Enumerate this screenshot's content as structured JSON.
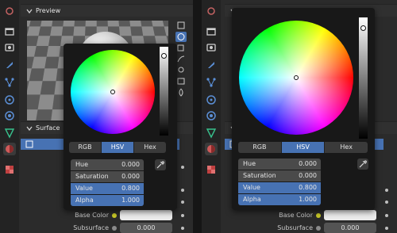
{
  "preview_header": {
    "label": "Preview"
  },
  "surface_header": {
    "label": "Surface"
  },
  "picker": {
    "modes": [
      "RGB",
      "HSV",
      "Hex"
    ],
    "active_mode": "HSV",
    "fields": [
      {
        "name": "Hue",
        "value": "0.000"
      },
      {
        "name": "Saturation",
        "value": "0.000"
      },
      {
        "name": "Value",
        "value": "0.800"
      },
      {
        "name": "Alpha",
        "value": "1.000"
      }
    ]
  },
  "left_rows": [
    {
      "label": "Base Color",
      "value": ""
    },
    {
      "label": "Subsurface",
      "value": "0.000"
    }
  ],
  "right_rows": [
    {
      "label": "Base Color",
      "value": ""
    },
    {
      "label": "Subsurface",
      "value": "0.000"
    }
  ],
  "partial_label": "S",
  "colors": {
    "accent": "#4772b3",
    "socket_yellow": "#c7c727",
    "panel": "#2b2b2b"
  },
  "icons": [
    "tool-icon",
    "render-icon",
    "output-icon",
    "view-layer-icon",
    "scene-icon",
    "world-icon",
    "object-icon",
    "modifier-icon",
    "particles-icon",
    "physics-icon",
    "constraints-icon",
    "data-icon",
    "material-icon",
    "texture-icon"
  ]
}
